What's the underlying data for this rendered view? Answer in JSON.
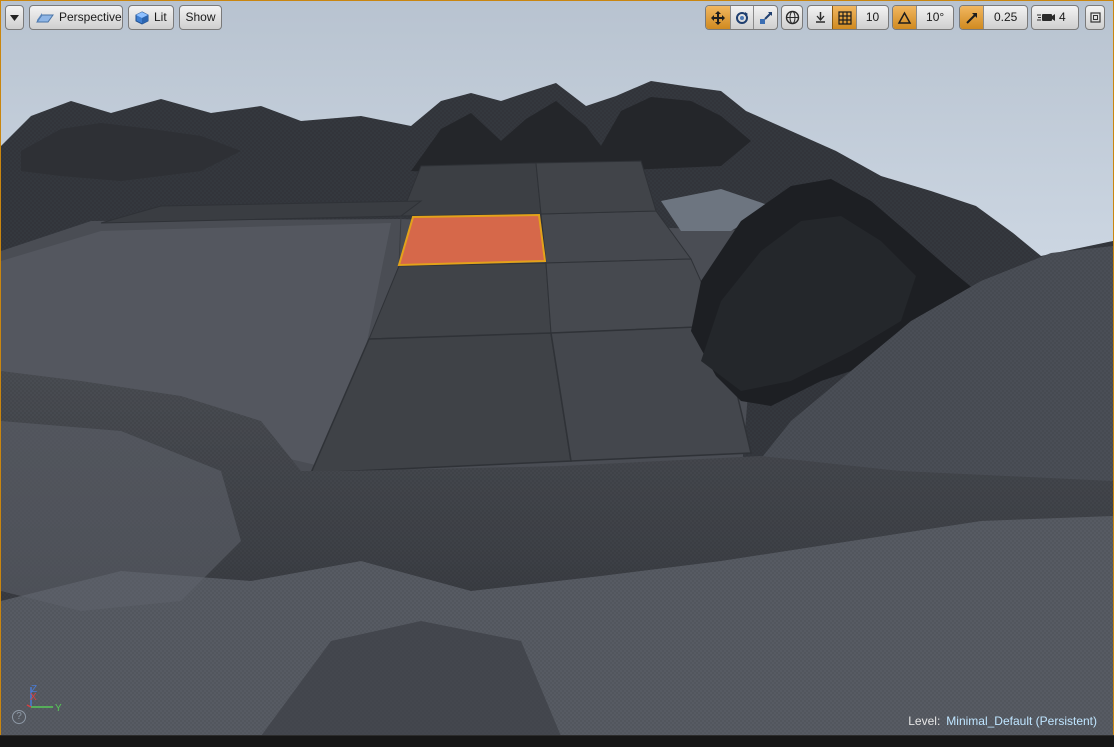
{
  "viewport": {
    "accent_color": "#d08a20",
    "selection_color": "#d9664a",
    "projection_label": "Perspective",
    "view_mode_label": "Lit",
    "show_label": "Show"
  },
  "toolbar_right": {
    "grid_snap_value": "10",
    "rotation_snap_value": "10°",
    "scale_snap_value": "0.25",
    "camera_speed_value": "4",
    "icons": [
      "translate-icon",
      "rotate-icon",
      "scale-icon",
      "world-local-icon",
      "surface-snap-icon",
      "grid-icon",
      "rotation-snap-icon",
      "scale-snap-icon",
      "camera-speed-icon",
      "maximize-icon"
    ]
  },
  "status": {
    "level_label": "Level:",
    "level_name": "Minimal_Default (Persistent)"
  },
  "axis": {
    "z_label": "Z",
    "x_label": "X",
    "y_label": "Y"
  },
  "help": {
    "glyph": "?"
  }
}
